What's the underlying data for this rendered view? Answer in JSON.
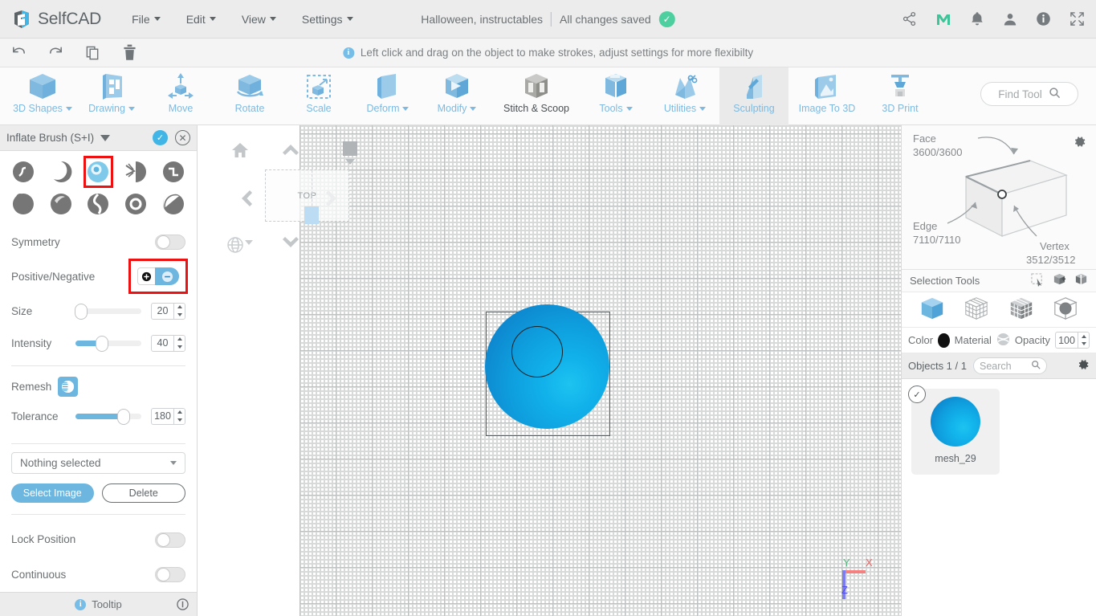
{
  "topbar": {
    "brand": "SelfCAD",
    "menus": [
      "File",
      "Edit",
      "View",
      "Settings"
    ],
    "doc_title": "Halloween, instructables",
    "save_status": "All changes saved",
    "icons": [
      "share-icon",
      "maker-m-icon",
      "bell-icon",
      "user-icon",
      "info-icon",
      "fullscreen-icon"
    ]
  },
  "undo_row": {
    "icons": [
      "undo-icon",
      "redo-icon",
      "copy-icon",
      "trash-icon"
    ],
    "hint": "Left click and drag on the object to make strokes, adjust settings for more flexibilty"
  },
  "ribbon": {
    "items": [
      {
        "label": "3D Shapes",
        "dropdown": true,
        "active": false,
        "dark": false
      },
      {
        "label": "Drawing",
        "dropdown": true,
        "active": false,
        "dark": false
      },
      {
        "label": "Move",
        "dropdown": false,
        "active": false,
        "dark": false
      },
      {
        "label": "Rotate",
        "dropdown": false,
        "active": false,
        "dark": false
      },
      {
        "label": "Scale",
        "dropdown": false,
        "active": false,
        "dark": false
      },
      {
        "label": "Deform",
        "dropdown": true,
        "active": false,
        "dark": false
      },
      {
        "label": "Modify",
        "dropdown": true,
        "active": false,
        "dark": false
      },
      {
        "label": "Stitch & Scoop",
        "dropdown": false,
        "active": false,
        "dark": true
      },
      {
        "label": "Tools",
        "dropdown": true,
        "active": false,
        "dark": false
      },
      {
        "label": "Utilities",
        "dropdown": true,
        "active": false,
        "dark": false
      },
      {
        "label": "Sculpting",
        "dropdown": false,
        "active": true,
        "dark": false
      },
      {
        "label": "Image To 3D",
        "dropdown": false,
        "active": false,
        "dark": false
      },
      {
        "label": "3D Print",
        "dropdown": false,
        "active": false,
        "dark": false
      }
    ],
    "find_tool_placeholder": "Find Tool"
  },
  "left_panel": {
    "title": "Inflate Brush (S+I)",
    "brushes_row1": [
      "clay-brush-icon",
      "flatten-brush-icon",
      "inflate-brush-icon",
      "pinch-brush-icon",
      "crease-brush-icon"
    ],
    "brushes_row2": [
      "blob-brush-icon",
      "smooth-brush-icon",
      "twist-brush-icon",
      "ring-brush-icon",
      "fill-brush-icon"
    ],
    "selected_brush_index": 2,
    "symmetry_label": "Symmetry",
    "symmetry_on": false,
    "positive_negative_label": "Positive/Negative",
    "positive_negative_value": "negative",
    "size_label": "Size",
    "size_value": "20",
    "size_percent": 8,
    "intensity_label": "Intensity",
    "intensity_value": "40",
    "intensity_percent": 40,
    "remesh_label": "Remesh",
    "tolerance_label": "Tolerance",
    "tolerance_value": "180",
    "tolerance_percent": 80,
    "image_select_value": "Nothing selected",
    "select_image_button": "Select Image",
    "delete_button": "Delete",
    "lock_position_label": "Lock Position",
    "lock_position_on": false,
    "continuous_label": "Continuous",
    "continuous_on": false,
    "tooltip_label": "Tooltip"
  },
  "viewport": {
    "view_cube_label": "TOP",
    "axis_labels": {
      "x": "X",
      "y": "Y",
      "z": "Z"
    },
    "axis_colors": {
      "x": "#f06262",
      "y": "#55b97f",
      "z": "#6464e6"
    }
  },
  "right_panel": {
    "face_label": "Face",
    "face_count": "3600/3600",
    "edge_label": "Edge",
    "edge_count": "7110/7110",
    "vertex_label": "Vertex",
    "vertex_count": "3512/3512",
    "selection_tools_label": "Selection Tools",
    "selection_tool_icons": [
      "rect-select-icon",
      "add-select-icon",
      "remove-select-icon"
    ],
    "mode_icons": [
      "object-mode-icon",
      "face-mode-icon",
      "polygon-mode-icon",
      "vertex-mode-icon"
    ],
    "color_label": "Color",
    "color_value": "#111111",
    "material_label": "Material",
    "opacity_label": "Opacity",
    "opacity_value": "100",
    "objects_label": "Objects 1 / 1",
    "search_placeholder": "Search",
    "objects": [
      {
        "name": "mesh_29",
        "selected": true
      }
    ]
  },
  "colors": {
    "accent": "#6cb6e0",
    "ribbon_icon": "#7fb9e0",
    "highlight_red": "#ee1111",
    "saved_green": "#4ecfa0"
  }
}
